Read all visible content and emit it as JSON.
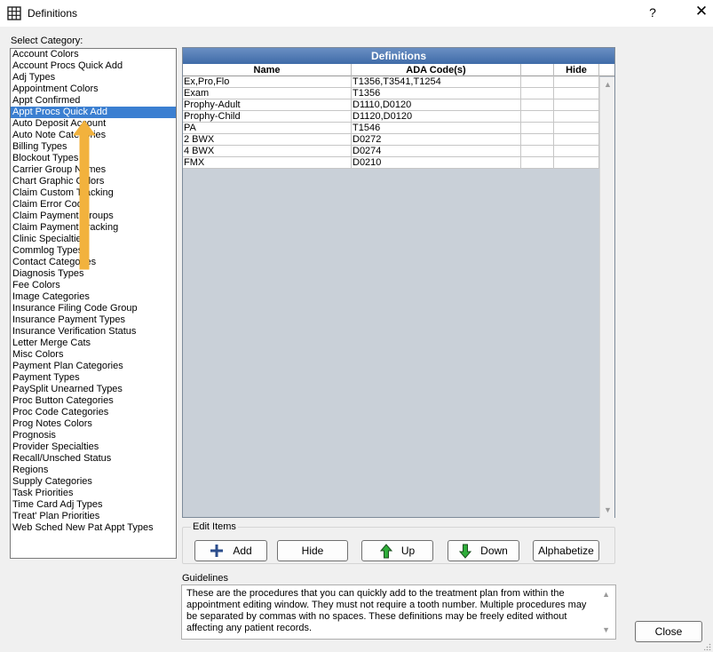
{
  "window": {
    "title": "Definitions",
    "help": "?",
    "close": "✕"
  },
  "categories": {
    "label": "Select Category:",
    "items": [
      "Account Colors",
      "Account Procs Quick Add",
      "Adj Types",
      "Appointment Colors",
      "Appt Confirmed",
      "Appt Procs Quick Add",
      "Auto Deposit Account",
      "Auto Note Categories",
      "Billing Types",
      "Blockout Types",
      "Carrier Group Names",
      "Chart Graphic Colors",
      "Claim Custom Tracking",
      "Claim Error Code",
      "Claim Payment Groups",
      "Claim Payment Tracking",
      "Clinic Specialties",
      "Commlog Types",
      "Contact Categories",
      "Diagnosis Types",
      "Fee Colors",
      "Image Categories",
      "Insurance Filing Code Group",
      "Insurance Payment Types",
      "Insurance Verification Status",
      "Letter Merge Cats",
      "Misc Colors",
      "Payment Plan Categories",
      "Payment Types",
      "PaySplit Unearned Types",
      "Proc Button Categories",
      "Proc Code Categories",
      "Prog Notes Colors",
      "Prognosis",
      "Provider Specialties",
      "Recall/Unsched Status",
      "Regions",
      "Supply Categories",
      "Task Priorities",
      "Time Card Adj Types",
      "Treat' Plan Priorities",
      "Web Sched New Pat Appt Types"
    ],
    "selected_index": 5
  },
  "grid": {
    "title": "Definitions",
    "columns": {
      "name": "Name",
      "code": "ADA Code(s)",
      "blank": "",
      "hide": "Hide"
    },
    "rows": [
      {
        "name": "Ex,Pro,Flo",
        "code": "T1356,T3541,T1254"
      },
      {
        "name": "Exam",
        "code": "T1356"
      },
      {
        "name": "Prophy-Adult",
        "code": "D1110,D0120"
      },
      {
        "name": "Prophy-Child",
        "code": "D1120,D0120"
      },
      {
        "name": "PA",
        "code": "T1546"
      },
      {
        "name": "2 BWX",
        "code": "D0272"
      },
      {
        "name": "4 BWX",
        "code": "D0274"
      },
      {
        "name": "FMX",
        "code": "D0210"
      }
    ]
  },
  "edit_items": {
    "label": "Edit Items",
    "add": "Add",
    "hide": "Hide",
    "up": "Up",
    "down": "Down",
    "alphabetize": "Alphabetize"
  },
  "guidelines": {
    "label": "Guidelines",
    "text": "These are the procedures that you can quickly add to the treatment plan from within the appointment editing window.  They must not require a tooth number. Multiple procedures may be separated by commas with no spaces. These definitions may be freely edited without affecting any patient records."
  },
  "footer": {
    "close": "Close"
  },
  "colors": {
    "selection": "#3b7fd1",
    "arrow": "#f2b23d",
    "grid_header": "#3f6ba8",
    "grid_bg": "#c9d0d8"
  }
}
